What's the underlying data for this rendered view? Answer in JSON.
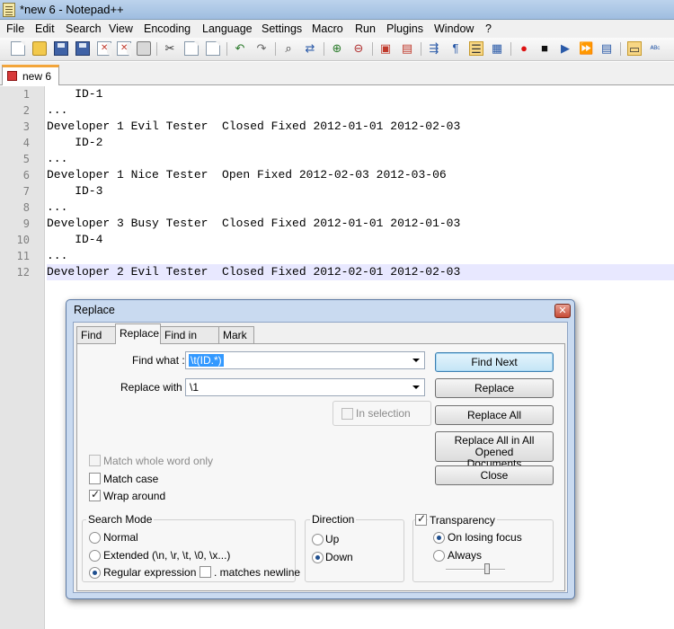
{
  "window": {
    "title": "*new  6 - Notepad++"
  },
  "menu": [
    "File",
    "Edit",
    "Search",
    "View",
    "Encoding",
    "Language",
    "Settings",
    "Macro",
    "Run",
    "Plugins",
    "Window",
    "?"
  ],
  "toolbar": {
    "icons": [
      "new-file-icon",
      "open-file-icon",
      "save-icon",
      "save-all-icon",
      "close-icon",
      "close-all-icon",
      "print-icon",
      "cut-icon",
      "copy-icon",
      "paste-icon",
      "undo-icon",
      "redo-icon",
      "find-icon",
      "replace-icon",
      "zoom-in-icon",
      "zoom-out-icon",
      "sync-vertical-icon",
      "sync-horizontal-icon",
      "word-wrap-icon",
      "show-all-chars-icon",
      "indent-guide-icon",
      "doc-map-icon",
      "record-macro-icon",
      "stop-record-icon",
      "play-macro-icon",
      "run-macro-multiple-icon",
      "save-macro-icon",
      "monitoring-icon",
      "spell-check-icon"
    ]
  },
  "tab": {
    "label": "new  6"
  },
  "editor": {
    "lines": [
      {
        "num": "1",
        "text": "    ID-1"
      },
      {
        "num": "2",
        "text": "..."
      },
      {
        "num": "3",
        "text": "Developer 1 Evil Tester  Closed Fixed 2012-01-01 2012-02-03"
      },
      {
        "num": "4",
        "text": "    ID-2"
      },
      {
        "num": "5",
        "text": "..."
      },
      {
        "num": "6",
        "text": "Developer 1 Nice Tester  Open Fixed 2012-02-03 2012-03-06"
      },
      {
        "num": "7",
        "text": "    ID-3"
      },
      {
        "num": "8",
        "text": "..."
      },
      {
        "num": "9",
        "text": "Developer 3 Busy Tester  Closed Fixed 2012-01-01 2012-01-03"
      },
      {
        "num": "10",
        "text": "    ID-4"
      },
      {
        "num": "11",
        "text": "..."
      },
      {
        "num": "12",
        "text": "Developer 2 Evil Tester  Closed Fixed 2012-02-01 2012-02-03"
      }
    ],
    "current_line": "12"
  },
  "dialog": {
    "title": "Replace",
    "tabs": [
      "Find",
      "Replace",
      "Find in Files",
      "Mark"
    ],
    "selected_tab": "Replace",
    "find_label": "Find what :",
    "find_value": "\\t(ID.*)",
    "replace_label": "Replace with :",
    "replace_value": "\\1",
    "in_selection": "In selection",
    "buttons": {
      "find_next": "Find Next",
      "replace": "Replace",
      "replace_all": "Replace All",
      "replace_all_opened_1": "Replace All in All Opened",
      "replace_all_opened_2": "Documents",
      "close": "Close"
    },
    "options": {
      "match_whole_word": "Match whole word only",
      "match_case": "Match case",
      "wrap_around": "Wrap around"
    },
    "search_mode": {
      "title": "Search Mode",
      "normal": "Normal",
      "extended": "Extended (\\n, \\r, \\t, \\0, \\x...)",
      "regex": "Regular expression",
      "matches_newline": ". matches newline",
      "selected": "regex"
    },
    "direction": {
      "title": "Direction",
      "up": "Up",
      "down": "Down",
      "selected": "down"
    },
    "transparency": {
      "title": "Transparency",
      "on_losing_focus": "On losing focus",
      "always": "Always",
      "selected": "on_losing_focus"
    }
  }
}
